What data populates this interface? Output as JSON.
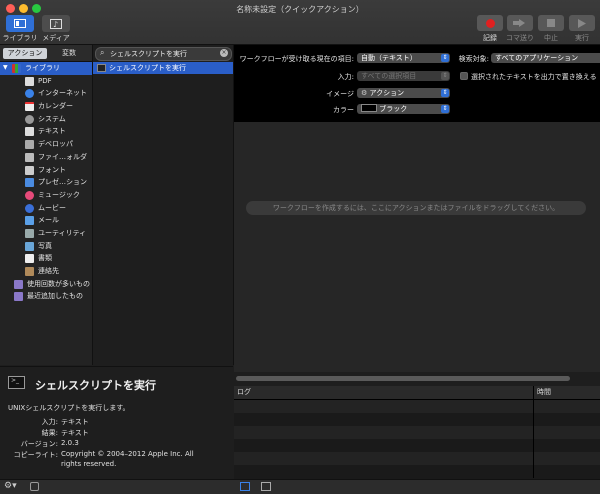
{
  "window": {
    "title": "名称未設定（クイックアクション）"
  },
  "toolbar": {
    "library_label": "ライブラリ",
    "media_label": "メディア",
    "record_label": "記録",
    "step_label": "コマ送り",
    "stop_label": "中止",
    "run_label": "実行"
  },
  "library": {
    "tab_actions": "アクション",
    "tab_variables": "変数",
    "items": [
      {
        "label": "ライブラリ",
        "icon": "library-icon"
      },
      {
        "label": "PDF",
        "icon": "pdf-icon"
      },
      {
        "label": "インターネット",
        "icon": "internet-icon"
      },
      {
        "label": "カレンダー",
        "icon": "calendar-icon"
      },
      {
        "label": "システム",
        "icon": "system-icon"
      },
      {
        "label": "テキスト",
        "icon": "text-icon"
      },
      {
        "label": "デベロッパ",
        "icon": "developer-icon"
      },
      {
        "label": "ファイ…ォルダ",
        "icon": "folder-icon"
      },
      {
        "label": "フォント",
        "icon": "font-icon"
      },
      {
        "label": "プレゼ…ション",
        "icon": "presentation-icon"
      },
      {
        "label": "ミュージック",
        "icon": "music-icon"
      },
      {
        "label": "ムービー",
        "icon": "movie-icon"
      },
      {
        "label": "メール",
        "icon": "mail-icon"
      },
      {
        "label": "ユーティリティ",
        "icon": "utility-icon"
      },
      {
        "label": "写真",
        "icon": "photo-icon"
      },
      {
        "label": "書類",
        "icon": "document-icon"
      },
      {
        "label": "連絡先",
        "icon": "contacts-icon"
      },
      {
        "label": "使用回数が多いもの",
        "icon": "smart-folder-icon"
      },
      {
        "label": "最近追加したもの",
        "icon": "smart-folder-icon"
      }
    ]
  },
  "search": {
    "value": "シェルスクリプトを実行"
  },
  "actions": {
    "selected": "シェルスクリプトを実行"
  },
  "description": {
    "title": "シェルスクリプトを実行",
    "summary": "UNIXシェルスクリプトを実行します。",
    "input_label": "入力:",
    "input_value": "テキスト",
    "result_label": "結果:",
    "result_value": "テキスト",
    "version_label": "バージョン:",
    "version_value": "2.0.3",
    "copyright_label": "コピーライト:",
    "copyright_line1": "Copyright © 2004–2012 Apple Inc.  All",
    "copyright_line2": "rights reserved."
  },
  "config": {
    "receives_label": "ワークフローが受け取る現在の項目:",
    "receives_value": "自動（テキスト）",
    "search_in_label": "検索対象:",
    "search_in_value": "すべてのアプリケーション",
    "input_label": "入力:",
    "input_value": "すべての選択項目",
    "replace_label": "選択されたテキストを出力で置き換える",
    "image_label": "イメージ",
    "image_value": "アクション",
    "color_label": "カラー",
    "color_value": "ブラック"
  },
  "canvas": {
    "hint": "ワークフローを作成するには、ここにアクションまたはファイルをドラッグしてください。"
  },
  "log": {
    "col_log": "ログ",
    "col_time": "時間"
  }
}
